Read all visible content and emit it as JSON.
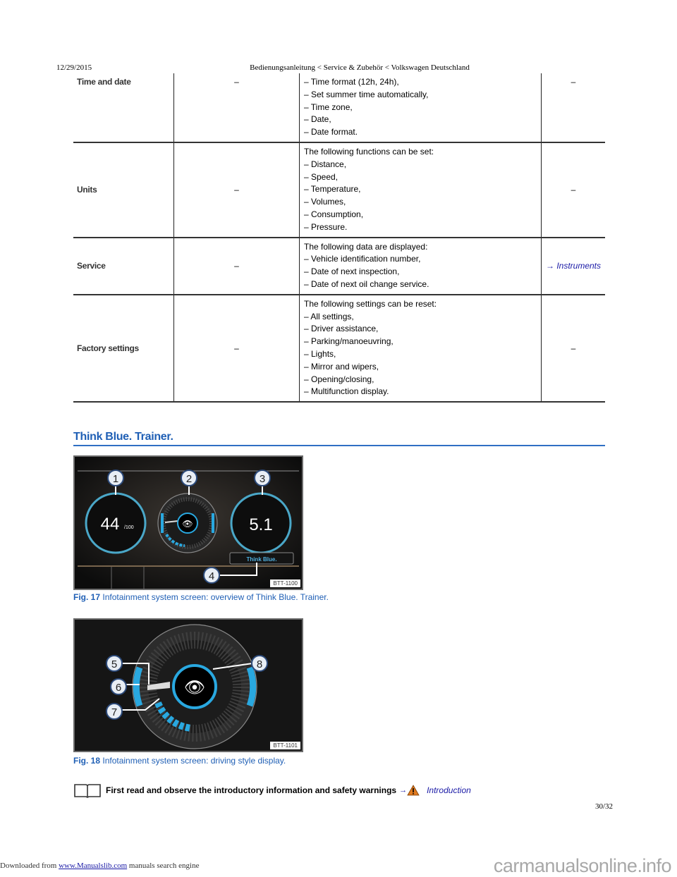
{
  "header": {
    "date": "12/29/2015",
    "title": "Bedienungsanleitung < Service & Zubehör < Volkswagen Deutschland"
  },
  "table": {
    "rows": [
      {
        "name": "Time and date",
        "col2": "–",
        "desc": [
          "– Time format (12h, 24h),",
          "– Set summer time automatically,",
          "– Time zone,",
          "– Date,",
          "– Date format."
        ],
        "ref": "–",
        "ref_is_link": false
      },
      {
        "name": "Units",
        "col2": "–",
        "desc": [
          "The following functions can be set:",
          "– Distance,",
          "– Speed,",
          "– Temperature,",
          "– Volumes,",
          "– Consumption,",
          "– Pressure."
        ],
        "ref": "–",
        "ref_is_link": false
      },
      {
        "name": "Service",
        "col2": "–",
        "desc": [
          "The following data are displayed:",
          "– Vehicle identification number,",
          "– Date of next inspection,",
          "– Date of next oil change service."
        ],
        "ref": "→ Instruments",
        "ref_is_link": true
      },
      {
        "name": "Factory settings",
        "col2": "–",
        "desc": [
          "The following settings can be reset:",
          "– All settings,",
          "– Driver assistance,",
          "– Parking/manoeuvring,",
          "– Lights,",
          "– Mirror and wipers,",
          "– Opening/closing,",
          "– Multifunction display."
        ],
        "ref": "–",
        "ref_is_link": false
      }
    ]
  },
  "section": {
    "title": "Think Blue. Trainer."
  },
  "figures": {
    "fig17": {
      "code": "BTT-1100",
      "caption_label": "Fig. 17",
      "caption_text": "Infotainment system screen: overview of Think Blue. Trainer.",
      "score_value": "44",
      "score_unit": "/100",
      "consumption_value": "5.1",
      "button_label": "Think Blue.",
      "callouts": [
        "1",
        "2",
        "3",
        "4"
      ]
    },
    "fig18": {
      "code": "BTT-1101",
      "caption_label": "Fig. 18",
      "caption_text": "Infotainment system screen: driving style display.",
      "callouts": [
        "5",
        "6",
        "7",
        "8"
      ]
    }
  },
  "note": {
    "text": "First read and observe the introductory information and safety warnings",
    "arrow": "→",
    "link": "Introduction"
  },
  "page_number": "30/32",
  "footer": {
    "prefix": "Downloaded from ",
    "link": "www.Manualslib.com",
    "suffix": " manuals search engine",
    "watermark": "carmanualsonline.info"
  },
  "colors": {
    "heading_blue": "#1f5fb5",
    "link_blue": "#1a1aa6",
    "display_cyan": "#29a8e0",
    "warning_orange": "#e07a1f"
  }
}
